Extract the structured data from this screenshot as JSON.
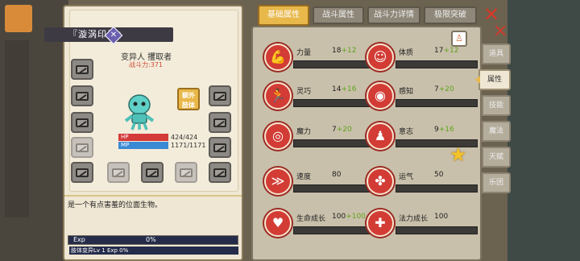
{
  "colors": {
    "accent": "#e8b84b",
    "stat_icon": "#d23c35",
    "bonus": "#5fa31c",
    "hp": "#d43a3a",
    "mp": "#3a89d4",
    "close": "#d63a2a"
  },
  "character": {
    "title": "『漩涡印记』",
    "race_line": "变异人 攫取者",
    "power": "战斗力:371",
    "hp_label": "HP",
    "hp_value": "424/424",
    "mp_label": "MP",
    "mp_value": "1171/1171",
    "extra_button": "额外\n肢体",
    "description": "是一个有点害羞的位面生物。",
    "exp_label": "Exp",
    "exp_value": "0%",
    "level_text": "肢体变异Lv 1 Exp     0%"
  },
  "tabs": [
    "基础属性",
    "战斗属性",
    "战斗力详情",
    "极限突破"
  ],
  "side_tabs": [
    "道具",
    "属性",
    "技能",
    "魔法",
    "天赋",
    "乐团"
  ],
  "stats": [
    {
      "label": "力量",
      "base": "18",
      "bonus": "+12",
      "icon": "strength-icon"
    },
    {
      "label": "体质",
      "base": "17",
      "bonus": "+12",
      "icon": "constitution-icon"
    },
    {
      "label": "灵巧",
      "base": "14",
      "bonus": "+16",
      "icon": "agility-icon"
    },
    {
      "label": "感知",
      "base": "7",
      "bonus": "+20",
      "icon": "perception-icon"
    },
    {
      "label": "魔力",
      "base": "7",
      "bonus": "+20",
      "icon": "magic-icon"
    },
    {
      "label": "意志",
      "base": "9",
      "bonus": "+16",
      "icon": "will-icon"
    },
    {
      "label": "速度",
      "base": "80",
      "bonus": "",
      "icon": "speed-icon"
    },
    {
      "label": "运气",
      "base": "50",
      "bonus": "",
      "icon": "luck-icon"
    },
    {
      "label": "生命成长",
      "base": "100",
      "bonus": "+100",
      "icon": "life-growth-icon"
    },
    {
      "label": "法力成长",
      "base": "100",
      "bonus": "",
      "icon": "mana-growth-icon"
    }
  ]
}
